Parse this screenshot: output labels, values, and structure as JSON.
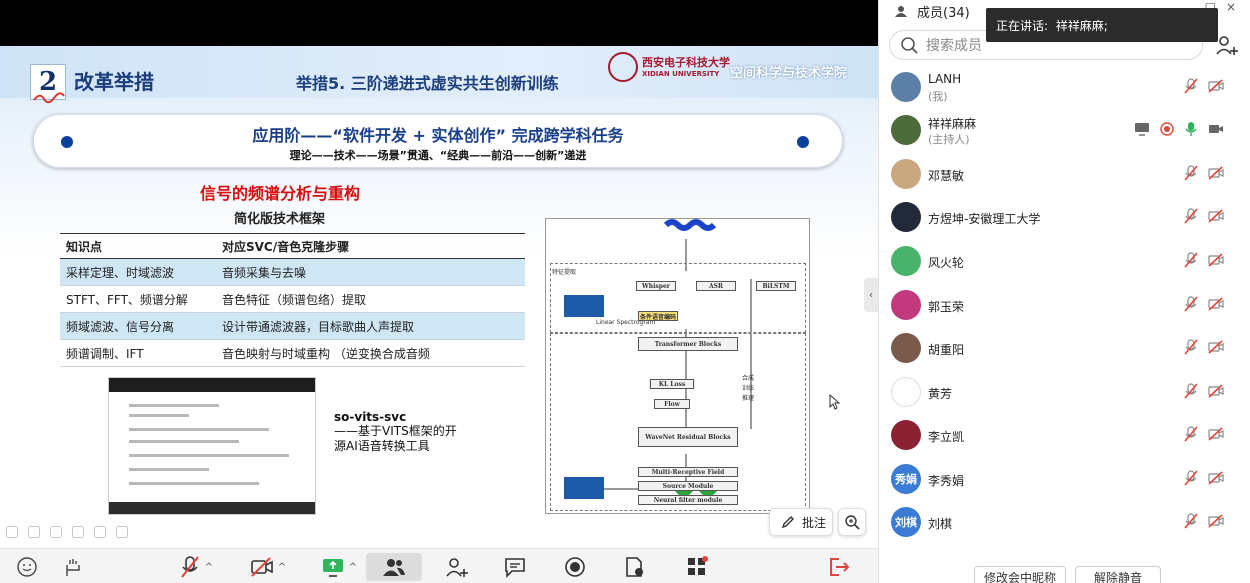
{
  "slide": {
    "section_number": "2",
    "section_title": "改革举措",
    "measure_title": "举措5. 三阶递进式虚实共生创新训练",
    "university_cn": "西安电子科技大学",
    "university_en": "XIDIAN UNIVERSITY",
    "school": "空间科学与技术学院",
    "banner_line1": "应用阶——“软件开发 + 实体创作” 完成跨学科任务",
    "banner_line2": "理论——技术——场景”贯通、“经典——前沿——创新”递进",
    "topic_title": "信号的频谱分析与重构",
    "framework_title": "简化版技术框架",
    "table": {
      "headers": [
        "知识点",
        "对应SVC/音色克隆步骤"
      ],
      "rows": [
        [
          "采样定理、时域滤波",
          "音频采集与去噪"
        ],
        [
          "STFT、FFT、频谱分解",
          "音色特征（频谱包络）提取"
        ],
        [
          "频域滤波、信号分离",
          "设计带通滤波器，目标歌曲人声提取"
        ],
        [
          "频谱调制、IFT",
          "音色映射与时域重构 （逆变换合成音频"
        ]
      ]
    },
    "tool_name": "so-vits-svc",
    "tool_desc": "——基于VITS框架的开源AI语音转换工具",
    "diagram": {
      "nodes": [
        "Whisper",
        "ASR",
        "BiLSTM",
        "Transformer Blocks",
        "KL Loss",
        "Flow",
        "WaveNet Residual Blocks",
        "Multi-Receptive Field",
        "Source Module",
        "Neural filter module"
      ],
      "labels": [
        "特征提取",
        "Linear Spectrogram",
        "条件语音编码",
        "合成",
        "训练",
        "推理"
      ]
    },
    "annot_label": "批注"
  },
  "panel": {
    "title": "成员(34)",
    "speaking_label": "正在讲话:",
    "speaking_name": "祥祥麻麻;",
    "search_placeholder": "搜索成员",
    "members": [
      {
        "name": "LANH",
        "sub": "(我)",
        "avatar_color": "#5b7fa6"
      },
      {
        "name": "祥祥麻麻",
        "sub": "(主持人)",
        "avatar_color": "#4c6b3a"
      },
      {
        "name": "邓慧敏",
        "sub": "",
        "avatar_color": "#c9a77f"
      },
      {
        "name": "方煜坤-安徽理工大学",
        "sub": "",
        "avatar_color": "#222a3a"
      },
      {
        "name": "风火轮",
        "sub": "",
        "avatar_color": "#49b36b"
      },
      {
        "name": "郭玉荣",
        "sub": "",
        "avatar_color": "#c23a7d"
      },
      {
        "name": "胡重阳",
        "sub": "",
        "avatar_color": "#7a5a4a"
      },
      {
        "name": "黄芳",
        "sub": "",
        "avatar_color": "#ffffff"
      },
      {
        "name": "李立凯",
        "sub": "",
        "avatar_color": "#8b2233"
      },
      {
        "name": "李秀娟",
        "sub": "",
        "avatar_color": "#3a7bd5",
        "avatar_text": "秀娟"
      },
      {
        "name": "刘棋",
        "sub": "",
        "avatar_color": "#3a7bd5",
        "avatar_text": "刘棋"
      }
    ],
    "footer_buttons": [
      "修改会中昵称",
      "解除静音"
    ]
  },
  "colors": {
    "accent_blue": "#1a3f8a",
    "muted_red": "#e0453b",
    "unmuted_green": "#2fb35b",
    "highlight_row": "#cfe6f5"
  }
}
